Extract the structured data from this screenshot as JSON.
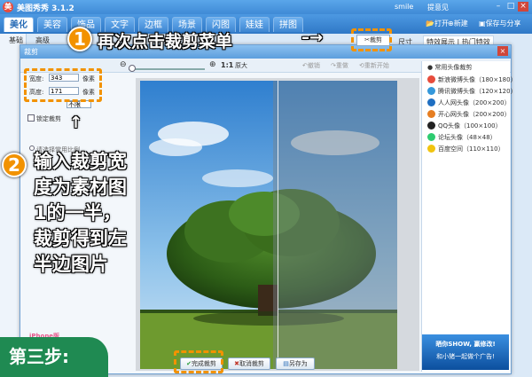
{
  "window": {
    "logo_letter": "美",
    "title": "美图秀秀 3.1.2",
    "user": "smile",
    "tool": "提意见"
  },
  "tabs": [
    "美化",
    "美容",
    "饰品",
    "文字",
    "边框",
    "场景",
    "闪图",
    "娃娃",
    "拼图"
  ],
  "toolbar": {
    "open": "打开",
    "new": "新建",
    "save_share": "保存与分享"
  },
  "left_panel_tabs": [
    "基础",
    "高级"
  ],
  "right_header": [
    "特效展示",
    "热门特效"
  ],
  "dialog": {
    "title": "裁剪",
    "zoom_label": "1:1",
    "original_label": "原大",
    "undo": "撤销",
    "redo": "重做",
    "reset": "重新开始",
    "crop_menu": "裁剪",
    "size_label": "尺寸",
    "width_label": "宽度:",
    "width_value": "343",
    "height_label": "高度:",
    "height_value": "171",
    "unit_px": "像素",
    "lock_ratio": "锁定裁剪",
    "select_ratio": "请选择常用比例",
    "ratio_value": "不限",
    "common_avatar": "常用头像裁剪",
    "avatar_presets": [
      "新浪微博头像（180×180）",
      "腾讯微博头像（120×120）",
      "人人网头像（200×200）",
      "开心网头像（200×200）",
      "QQ头像（100×100）",
      "论坛头像（48×48）",
      "百度空间（110×110）"
    ],
    "finish": "完成裁剪",
    "cancel": "取消裁剪",
    "save_as": "另存为",
    "banner": "晒你SHOW, 赢修改!",
    "banner_sub": "和小猪一起做个广告!",
    "left_ad": "iPhone版"
  },
  "annotations": {
    "n1": "1",
    "step1": "再次点击裁剪菜单",
    "n2": "2",
    "step2_lines": [
      "输入裁剪宽",
      "度为素材图",
      "1的一半，",
      "裁剪得到左",
      "半边图片"
    ],
    "step3": "第三步:"
  },
  "colors": {
    "accent": "#f29200",
    "titlebar": "#3f8ad6",
    "step3_bg": "#1f8a52"
  }
}
